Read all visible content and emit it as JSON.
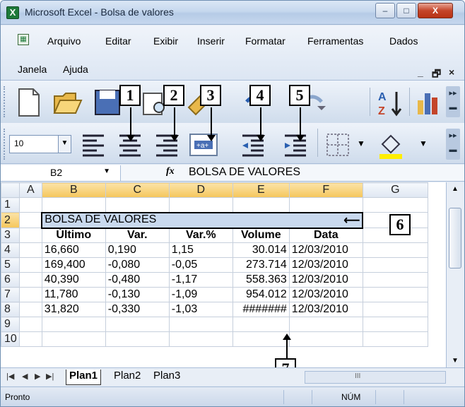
{
  "window": {
    "title": "Microsoft Excel - Bolsa de valores",
    "min_glyph": "–",
    "max_glyph": "□",
    "close_glyph": "X"
  },
  "menu": {
    "items": [
      "Arquivo",
      "Editar",
      "Exibir",
      "Inserir",
      "Formatar",
      "Ferramentas",
      "Dados",
      "Janela",
      "Ajuda"
    ],
    "mdi_min": "_",
    "mdi_restore": "🗗",
    "mdi_close": "×"
  },
  "toolbar": {
    "font_size": "10",
    "callouts": [
      "1",
      "2",
      "3",
      "4",
      "5",
      "6",
      "7"
    ]
  },
  "formula_bar": {
    "name_box": "B2",
    "fx": "fx",
    "value": "BOLSA DE VALORES"
  },
  "grid": {
    "columns": [
      "A",
      "B",
      "C",
      "D",
      "E",
      "F",
      "G"
    ],
    "rows": [
      "1",
      "2",
      "3",
      "4",
      "5",
      "6",
      "7",
      "8",
      "9",
      "10"
    ],
    "title": "BOLSA DE VALORES",
    "headers": [
      "Último",
      "Var.",
      "Var.%",
      "Volume",
      "Data"
    ],
    "data": [
      [
        "16,660",
        "0,190",
        "1,15",
        "30.014",
        "12/03/2010"
      ],
      [
        "169,400",
        "-0,080",
        "-0,05",
        "273.714",
        "12/03/2010"
      ],
      [
        "40,390",
        "-0,480",
        "-1,17",
        "558.363",
        "12/03/2010"
      ],
      [
        "11,780",
        "-0,130",
        "-1,09",
        "954.012",
        "12/03/2010"
      ],
      [
        "31,820",
        "-0,330",
        "-1,03",
        "#######",
        "12/03/2010"
      ]
    ]
  },
  "sheets": {
    "tabs": [
      "Plan1",
      "Plan2",
      "Plan3"
    ],
    "active": "Plan1",
    "hscroll_grip": "III"
  },
  "status": {
    "mode": "Pronto",
    "num": "NÚM"
  },
  "colors": {
    "selection": "#c9d9ee",
    "header_selected": "#f5c65b"
  }
}
